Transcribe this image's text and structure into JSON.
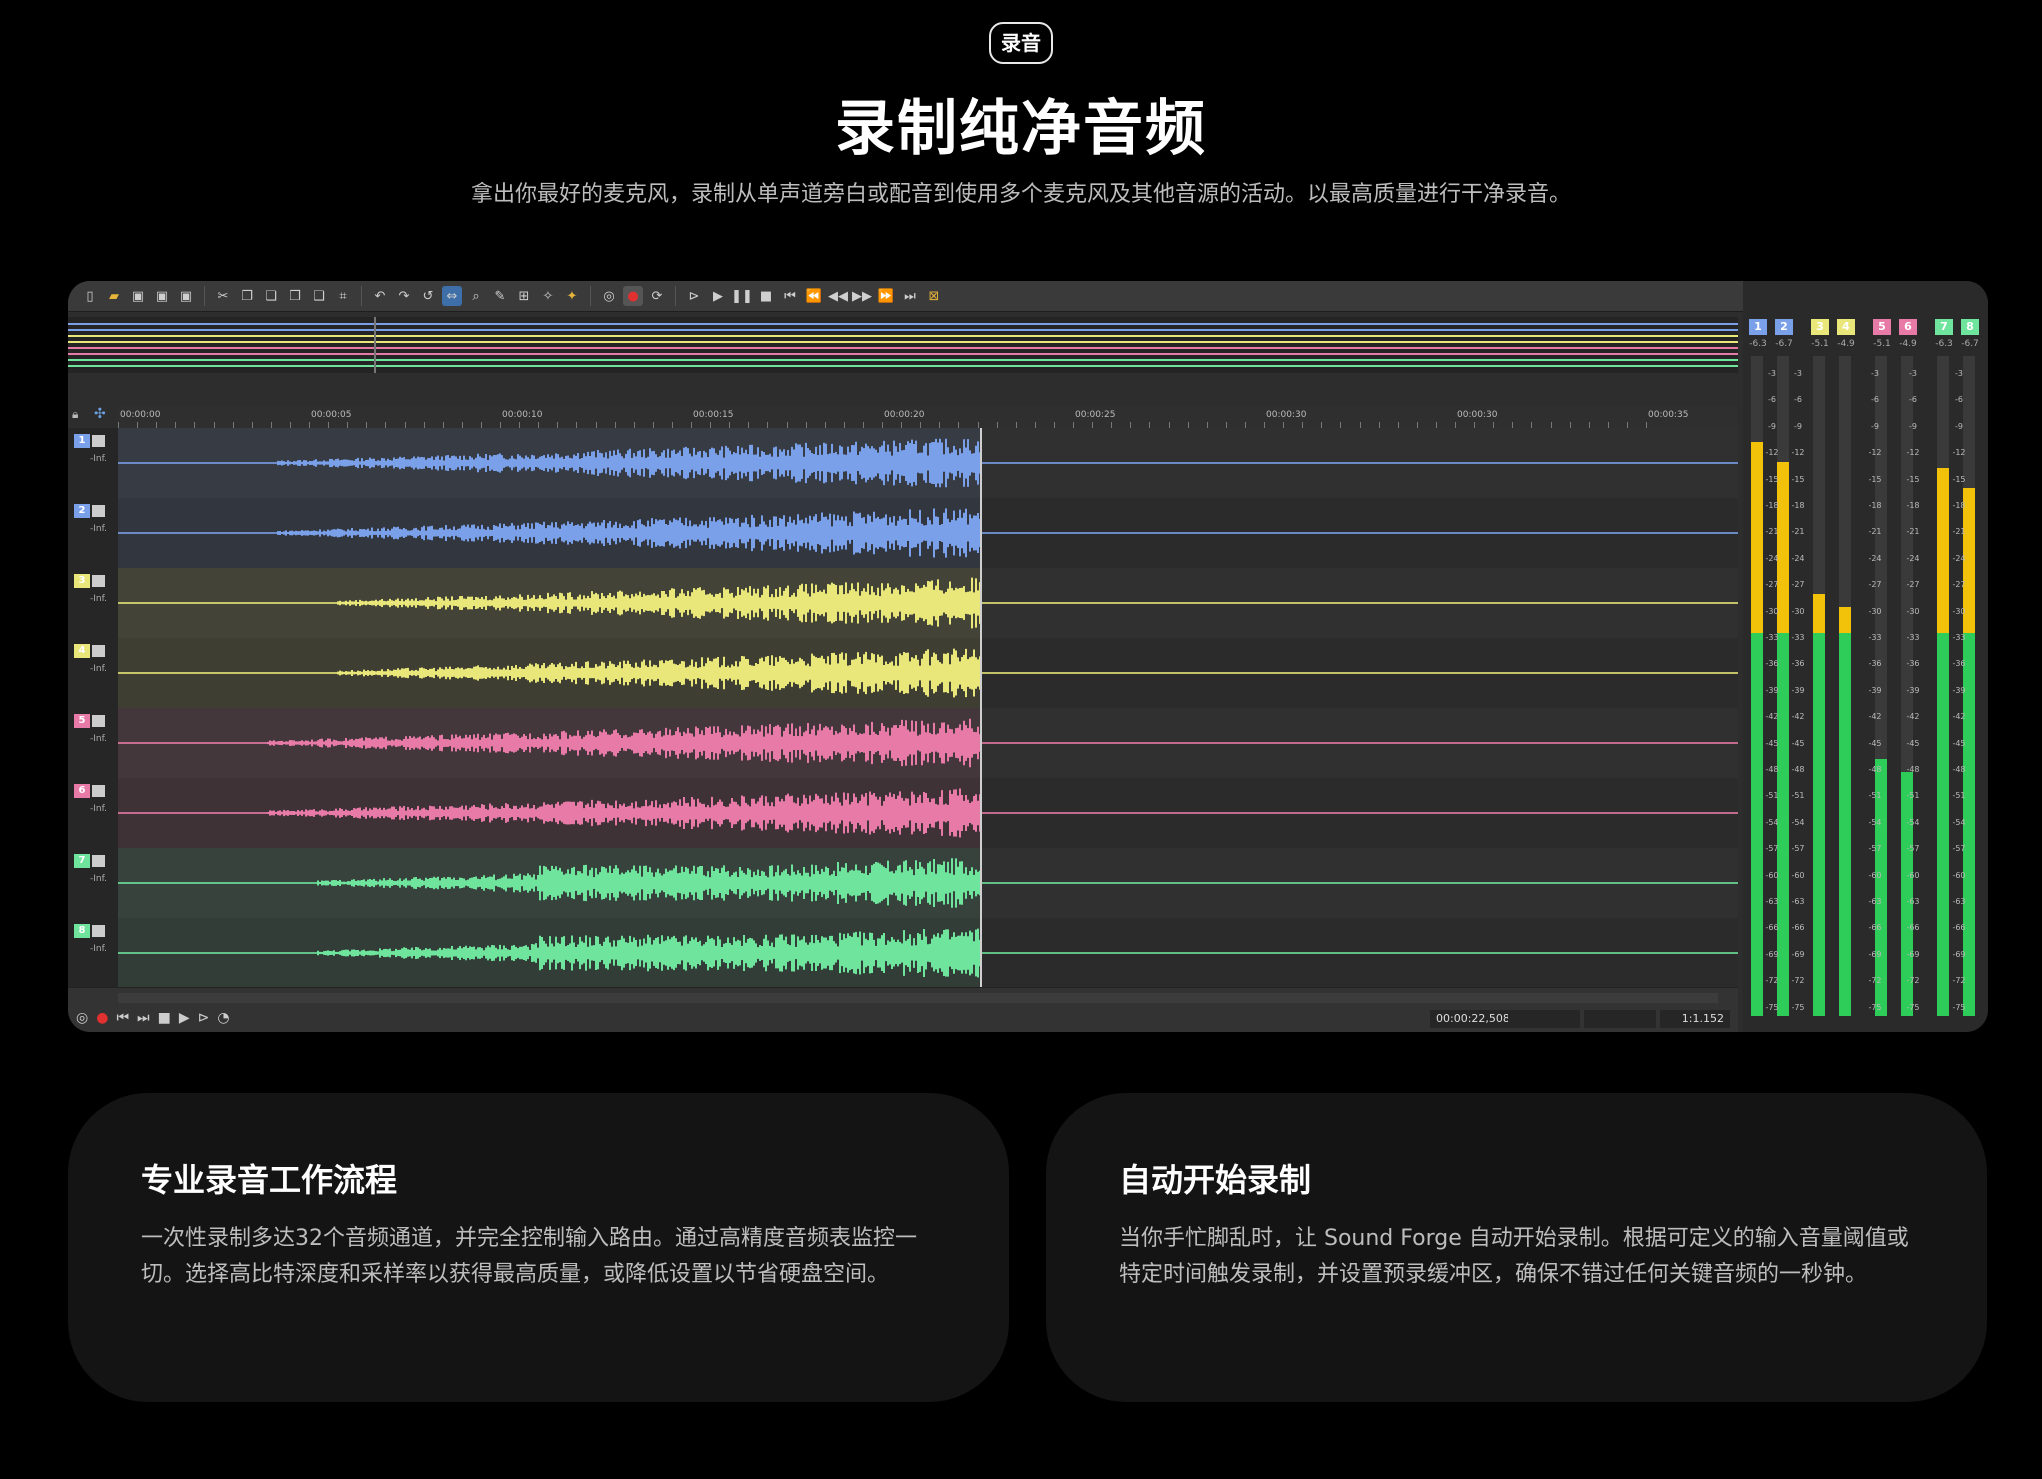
{
  "badge": "录音",
  "title": "录制纯净音频",
  "subtitle": "拿出你最好的麦克风，录制从单声道旁白或配音到使用多个麦克风及其他音源的活动。以最高质量进行干净录音。",
  "editor": {
    "ruler_marks": [
      "00:00:00",
      "00:00:05",
      "00:00:10",
      "00:00:15",
      "00:00:20",
      "00:00:25",
      "00:00:30",
      "00:00:30",
      "00:00:35"
    ],
    "tracks": [
      {
        "num": "1",
        "inf": "-Inf.",
        "color": "#7aa0ea"
      },
      {
        "num": "2",
        "inf": "-Inf.",
        "color": "#7aa0ea"
      },
      {
        "num": "3",
        "inf": "-Inf.",
        "color": "#e9e77a"
      },
      {
        "num": "4",
        "inf": "-Inf.",
        "color": "#e9e77a"
      },
      {
        "num": "5",
        "inf": "-Inf.",
        "color": "#e87aa8"
      },
      {
        "num": "6",
        "inf": "-Inf.",
        "color": "#e87aa8"
      },
      {
        "num": "7",
        "inf": "-Inf.",
        "color": "#6fe49c"
      },
      {
        "num": "8",
        "inf": "-Inf.",
        "color": "#6fe49c"
      }
    ],
    "status_time": "00:00:22,508",
    "status_zoom": "1:1.152",
    "meters": {
      "channels": [
        "1",
        "2",
        "3",
        "4",
        "5",
        "6",
        "7",
        "8"
      ],
      "peaks": [
        "-6.3",
        "-6.7",
        "-5.1",
        "-4.9",
        "-5.1",
        "-4.9",
        "-6.3",
        "-6.7"
      ],
      "levels": [
        0.87,
        0.84,
        0.64,
        0.62,
        0.39,
        0.37,
        0.83,
        0.8
      ],
      "scale": [
        "-3",
        "-6",
        "-9",
        "-12",
        "-15",
        "-18",
        "-21",
        "-24",
        "-27",
        "-30",
        "-33",
        "-36",
        "-39",
        "-42",
        "-45",
        "-48",
        "-51",
        "-54",
        "-57",
        "-60",
        "-63",
        "-66",
        "-69",
        "-72",
        "-75"
      ]
    }
  },
  "cards": [
    {
      "title": "专业录音工作流程",
      "body": "一次性录制多达32个音频通道，并完全控制输入路由。通过高精度音频表监控一切。选择高比特深度和采样率以获得最高质量，或降低设置以节省硬盘空间。"
    },
    {
      "title": "自动开始录制",
      "body": "当你手忙脚乱时，让 Sound Forge 自动开始录制。根据可定义的输入音量阈值或特定时间触发录制，并设置预录缓冲区，确保不错过任何关键音频的一秒钟。"
    }
  ]
}
